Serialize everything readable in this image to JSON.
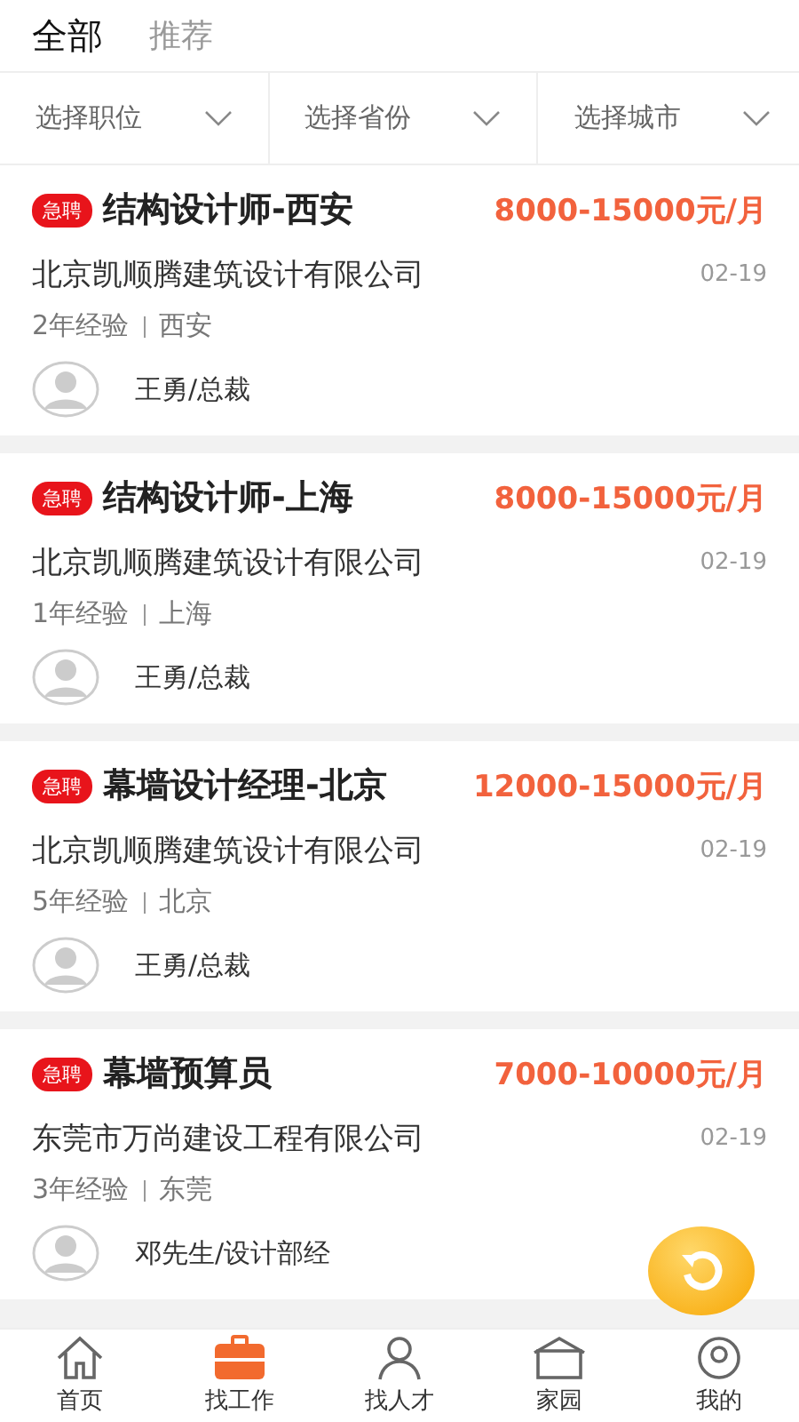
{
  "tabs": [
    {
      "label": "全部",
      "selected": true
    },
    {
      "label": "推荐",
      "selected": false
    }
  ],
  "filters": [
    "选择职位",
    "选择省份",
    "选择城市"
  ],
  "jobs": [
    {
      "badge": "急聘",
      "title": "结构设计师-西安",
      "salary": "8000-15000元/月",
      "company": "北京凯顺腾建筑设计有限公司",
      "date": "02-19",
      "experience": "2年经验",
      "city": "西安",
      "contact": "王勇/总裁"
    },
    {
      "badge": "急聘",
      "title": "结构设计师-上海",
      "salary": "8000-15000元/月",
      "company": "北京凯顺腾建筑设计有限公司",
      "date": "02-19",
      "experience": "1年经验",
      "city": "上海",
      "contact": "王勇/总裁"
    },
    {
      "badge": "急聘",
      "title": "幕墙设计经理-北京",
      "salary": "12000-15000元/月",
      "company": "北京凯顺腾建筑设计有限公司",
      "date": "02-19",
      "experience": "5年经验",
      "city": "北京",
      "contact": "王勇/总裁"
    },
    {
      "badge": "急聘",
      "title": "幕墙预算员",
      "salary": "7000-10000元/月",
      "company": "东莞市万尚建设工程有限公司",
      "date": "02-19",
      "experience": "3年经验",
      "city": "东莞",
      "contact": "邓先生/设计部经"
    }
  ],
  "nav": [
    {
      "kind": "home",
      "label": "首页",
      "selected": false
    },
    {
      "kind": "briefcase",
      "label": "找工作",
      "selected": true
    },
    {
      "kind": "person",
      "label": "找人才",
      "selected": false
    },
    {
      "kind": "community",
      "label": "家园",
      "selected": false
    },
    {
      "kind": "profile",
      "label": "我的",
      "selected": false
    }
  ]
}
